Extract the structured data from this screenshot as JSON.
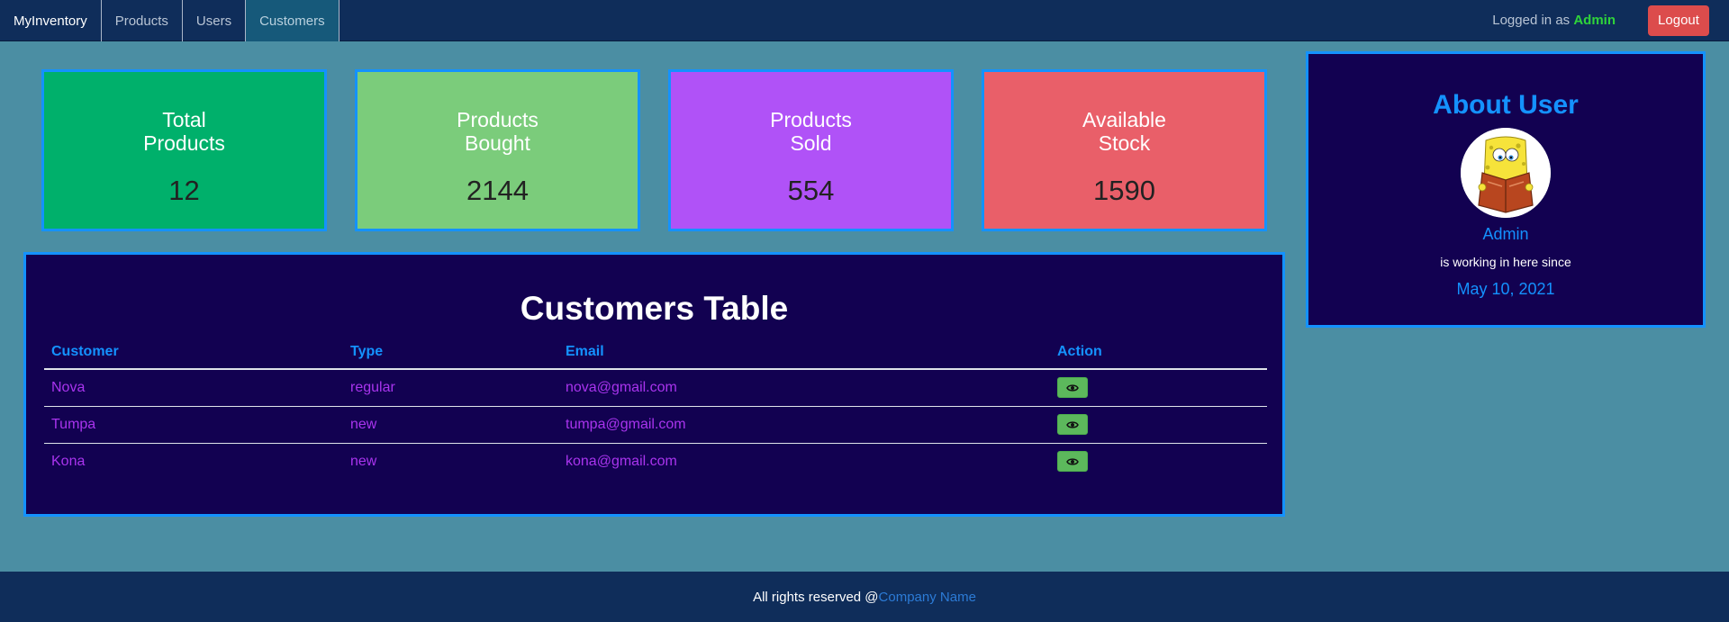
{
  "navbar": {
    "brand": "MyInventory",
    "links": [
      {
        "label": "Products",
        "active": false
      },
      {
        "label": "Users",
        "active": false
      },
      {
        "label": "Customers",
        "active": true
      }
    ],
    "logged_in_prefix": "Logged in as ",
    "logged_in_user": "Admin",
    "logout_label": "Logout"
  },
  "stats": [
    {
      "title": "Total Products",
      "value": "12",
      "color": "#00b06b"
    },
    {
      "title": "Products Bought",
      "value": "2144",
      "color": "#7bcc7b"
    },
    {
      "title": "Products Sold",
      "value": "554",
      "color": "#b052f7"
    },
    {
      "title": "Available Stock",
      "value": "1590",
      "color": "#e95f69"
    }
  ],
  "customers_table": {
    "title": "Customers Table",
    "columns": [
      "Customer",
      "Type",
      "Email",
      "Action"
    ],
    "rows": [
      {
        "customer": "Nova",
        "type": "regular",
        "email": "nova@gmail.com",
        "action_icon": "eye-icon"
      },
      {
        "customer": "Tumpa",
        "type": "new",
        "email": "tumpa@gmail.com",
        "action_icon": "eye-icon"
      },
      {
        "customer": "Kona",
        "type": "new",
        "email": "kona@gmail.com",
        "action_icon": "eye-icon"
      }
    ]
  },
  "about_user": {
    "title": "About User",
    "avatar_icon": "avatar-cartoon-reading-book",
    "name": "Admin",
    "text": "is working in here since",
    "date": "May 10, 2021"
  },
  "footer": {
    "rights": "All rights reserved @",
    "company": "Company Name"
  },
  "colors": {
    "background": "#4b8ea3",
    "navbar": "#0f2d5a",
    "panel": "#120151",
    "accent": "#1492ff",
    "row_text": "#a934ee",
    "logout": "#dc4c4c",
    "view_button": "#5cb85c"
  }
}
